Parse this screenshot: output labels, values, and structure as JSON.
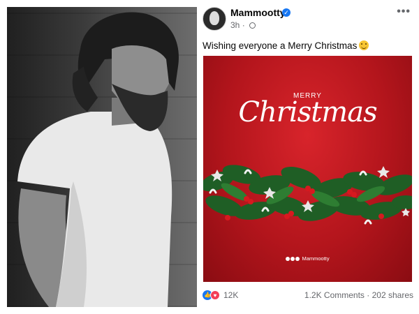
{
  "post": {
    "author": "Mammootty",
    "time": "3h",
    "caption": "Wishing everyone a Merry Christmas",
    "emoji": "smiling-face-icon",
    "card": {
      "merry": "MERRY",
      "christmas": "Christmas",
      "handle": "Mammootty"
    },
    "reactions_count": "12K",
    "comments": "1.2K Comments",
    "shares": "202 shares",
    "separator": "·"
  },
  "colors": {
    "card_red": "#b3151c",
    "verified_blue": "#1877f2",
    "love_red": "#f33e58"
  }
}
